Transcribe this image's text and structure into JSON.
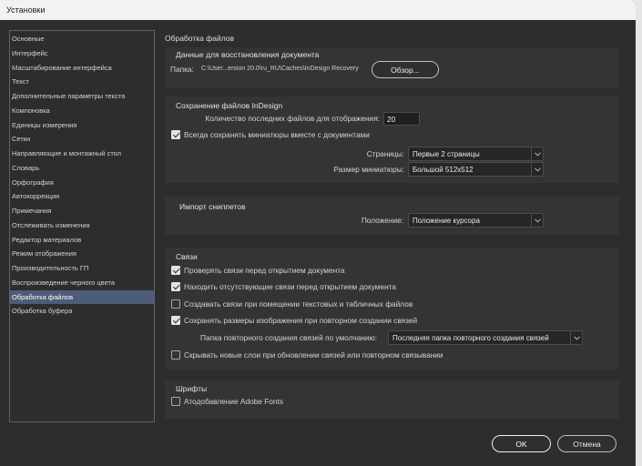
{
  "window": {
    "title": "Установки"
  },
  "sidebar": {
    "items": [
      {
        "label": "Основные"
      },
      {
        "label": "Интерфейс"
      },
      {
        "label": "Масштабирование интерфейса"
      },
      {
        "label": "Текст"
      },
      {
        "label": "Дополнительные параметры текста"
      },
      {
        "label": "Компоновка"
      },
      {
        "label": "Единицы измерения"
      },
      {
        "label": "Сетки"
      },
      {
        "label": "Направляющие и монтажный стол"
      },
      {
        "label": "Словарь"
      },
      {
        "label": "Орфография"
      },
      {
        "label": "Автокоррекция"
      },
      {
        "label": "Примечания"
      },
      {
        "label": "Отслеживать изменения"
      },
      {
        "label": "Редактор материалов"
      },
      {
        "label": "Режим отображения"
      },
      {
        "label": "Производительность ГП"
      },
      {
        "label": "Воспроизведение черного цвета"
      },
      {
        "label": "Обработка файлов",
        "selected": true
      },
      {
        "label": "Обработка буфера"
      }
    ]
  },
  "main": {
    "title": "Обработка файлов",
    "recovery": {
      "title": "Данные для восстановления документа",
      "folder_label": "Папка:",
      "folder_path": "C:\\User...ersion 20.0\\ru_RU\\Caches\\InDesign Recovery",
      "browse_label": "Обзор..."
    },
    "saving": {
      "title": "Сохранение файлов InDesign",
      "recent_label": "Количество последних файлов для отображения:",
      "recent_value": "20",
      "thumbnails": {
        "label": "Всегда сохранять миниатюры вместе с документами",
        "checked": true
      },
      "pages_label": "Страницы:",
      "pages_value": "Первые 2 страницы",
      "size_label": "Размер миниатюры:",
      "size_value": "Большой 512x512"
    },
    "snippets": {
      "title": "Импорт сниппетов",
      "position_label": "Положение:",
      "position_value": "Положение курсора"
    },
    "links": {
      "title": "Связи",
      "options": [
        {
          "label": "Проверять связи перед открытием документа",
          "checked": true
        },
        {
          "label": "Находить отсутствующие связи перед открытием документа",
          "checked": true
        },
        {
          "label": "Создавать связи при помещении текстовых и табличных файлов",
          "checked": false
        },
        {
          "label": "Сохранять размеры изображения при повторном создании связей",
          "checked": true
        },
        {
          "label": "Скрывать новые слои при обновлении связей или повторном связывании",
          "checked": false
        }
      ],
      "relink_folder_label": "Папка повторного создания связей по умолчанию:",
      "relink_folder_value": "Последняя папка повторного создания связей"
    },
    "fonts": {
      "title": "Шрифты",
      "auto_activate": {
        "label": "Атодобавление Adobe Fonts",
        "checked": false
      }
    }
  },
  "footer": {
    "ok_label": "OK",
    "cancel_label": "Отмена"
  },
  "colors": {
    "background": "#2d2d2d",
    "panel": "#343434",
    "sidebar_border": "#5d636b",
    "selection": "#4d5d79",
    "titlebar": "#f2f2f2"
  },
  "icons": {
    "dropdown": "chevron-down-icon"
  }
}
